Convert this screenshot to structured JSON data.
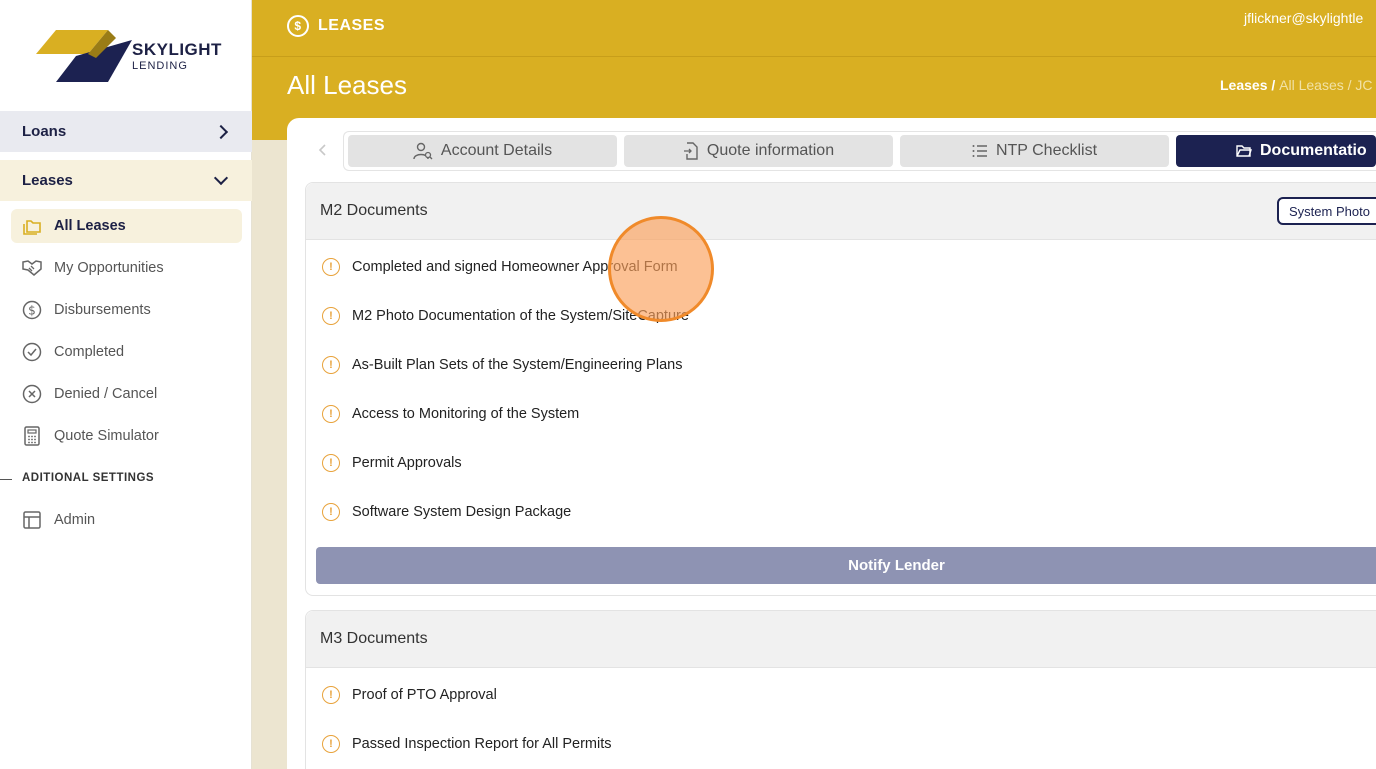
{
  "brand": {
    "name": "SKYLIGHT",
    "sub": "LENDING",
    "colors": {
      "navy": "#1c2251",
      "gold": "#d9af22"
    }
  },
  "sidebar": {
    "groups": [
      {
        "label": "Loans",
        "icon": "chevron-right-icon"
      },
      {
        "label": "Leases",
        "icon": "chevron-down-icon"
      }
    ],
    "items": [
      {
        "label": "All Leases",
        "icon": "folders-icon",
        "active": true
      },
      {
        "label": "My Opportunities",
        "icon": "handshake-icon"
      },
      {
        "label": "Disbursements",
        "icon": "dollar-circle-icon"
      },
      {
        "label": "Completed",
        "icon": "check-circle-icon"
      },
      {
        "label": "Denied / Cancel",
        "icon": "x-circle-icon"
      },
      {
        "label": "Quote Simulator",
        "icon": "calculator-icon"
      }
    ],
    "section_label": "ADITIONAL SETTINGS",
    "settings_items": [
      {
        "label": "Admin",
        "icon": "layout-icon"
      }
    ]
  },
  "header": {
    "module": "LEASES",
    "user": "jflickner@skylightle",
    "title": "All Leases",
    "breadcrumb": {
      "first": "Leases",
      "sep1": " / ",
      "second": "All Leases",
      "sep2": " / ",
      "third": "JC"
    }
  },
  "tabs": [
    {
      "label": "Account Details",
      "icon": "user-search-icon"
    },
    {
      "label": "Quote information",
      "icon": "file-import-icon"
    },
    {
      "label": "NTP Checklist",
      "icon": "list-icon"
    },
    {
      "label": "Documentatio",
      "icon": "folder-open-icon",
      "active": true
    }
  ],
  "m2": {
    "title": "M2 Documents",
    "photo_button": "System Photo",
    "docs": [
      "Completed and signed Homeowner Approval Form",
      "M2 Photo Documentation of the System/SiteCapture",
      "As-Built Plan Sets of the System/Engineering Plans",
      "Access to Monitoring of the System",
      "Permit Approvals",
      "Software System Design Package"
    ],
    "notify_label": "Notify Lender"
  },
  "m3": {
    "title": "M3 Documents",
    "docs": [
      "Proof of PTO Approval",
      "Passed Inspection Report for All Permits"
    ]
  }
}
